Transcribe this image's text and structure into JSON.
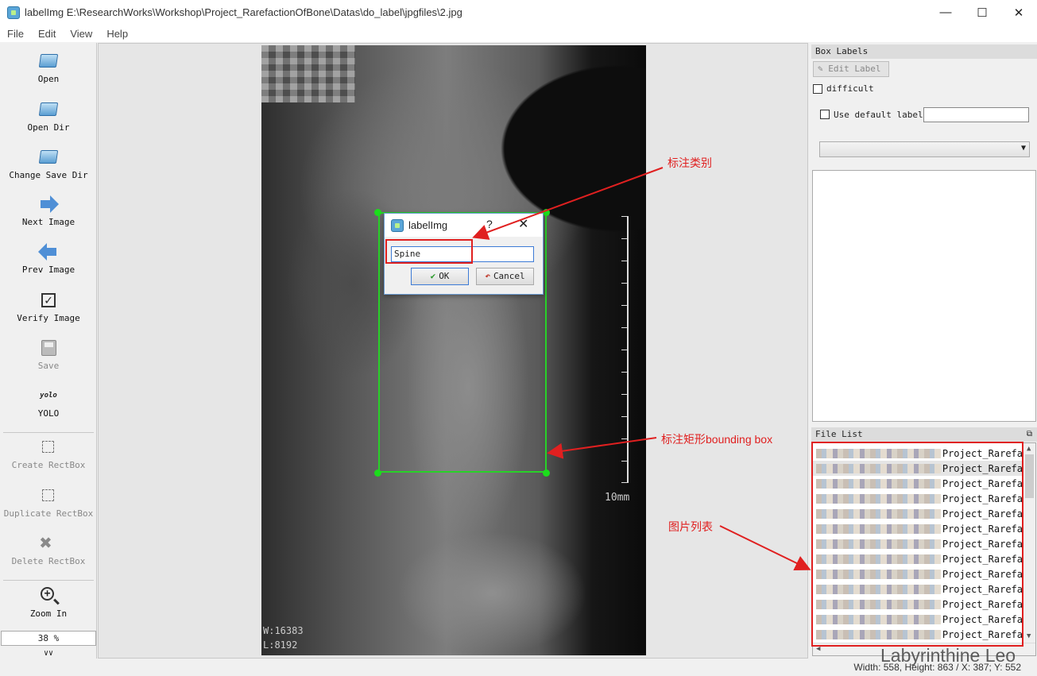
{
  "window": {
    "title": "labelImg E:\\ResearchWorks\\Workshop\\Project_RarefactionOfBone\\Datas\\do_label\\jpgfiles\\2.jpg"
  },
  "menu": [
    "File",
    "Edit",
    "View",
    "Help"
  ],
  "toolbar": {
    "open": "Open",
    "open_dir": "Open Dir",
    "change_save_dir": "Change Save Dir",
    "next_image": "Next Image",
    "prev_image": "Prev Image",
    "verify_image": "Verify Image",
    "save": "Save",
    "yolo_icon": "yolo",
    "yolo": "YOLO",
    "create_rectbox": "Create RectBox",
    "duplicate_rectbox": "Duplicate RectBox",
    "delete_rectbox": "Delete RectBox",
    "zoom_in": "Zoom In",
    "zoom_value": "38 %"
  },
  "image": {
    "scale_label": "10mm",
    "overlay_w": "W:16383",
    "overlay_l": "L:8192"
  },
  "dialog": {
    "title": "labelImg",
    "help": "?",
    "input_value": "Spine",
    "ok": "OK",
    "cancel": "Cancel"
  },
  "annotations": {
    "label_category": "标注类别",
    "bbox": "标注矩形bounding box",
    "image_list": "图片列表"
  },
  "box_labels": {
    "title": "Box Labels",
    "edit_label": "Edit Label",
    "difficult": "difficult",
    "use_default_label": "Use default label"
  },
  "file_list": {
    "title": "File List",
    "items": [
      "Project_Rarefa",
      "Project_Rarefa",
      "Project_Rarefa",
      "Project_Rarefa",
      "Project_Rarefa",
      "Project_Rarefa",
      "Project_Rarefa",
      "Project_Rarefa",
      "Project_Rarefa",
      "Project_Rarefa",
      "Project_Rarefa",
      "Project_Rarefa",
      "Project_Rarefa"
    ]
  },
  "status": {
    "text": "Width: 558, Height: 863 / X: 387; Y: 552"
  },
  "watermark": "Labyrinthine Leo",
  "icons": {
    "open": "folder-icon",
    "next": "arrow-right-icon",
    "prev": "arrow-left-icon",
    "verify": "checkbox-icon",
    "save": "floppy-icon",
    "zoom": "zoom-in-icon"
  }
}
